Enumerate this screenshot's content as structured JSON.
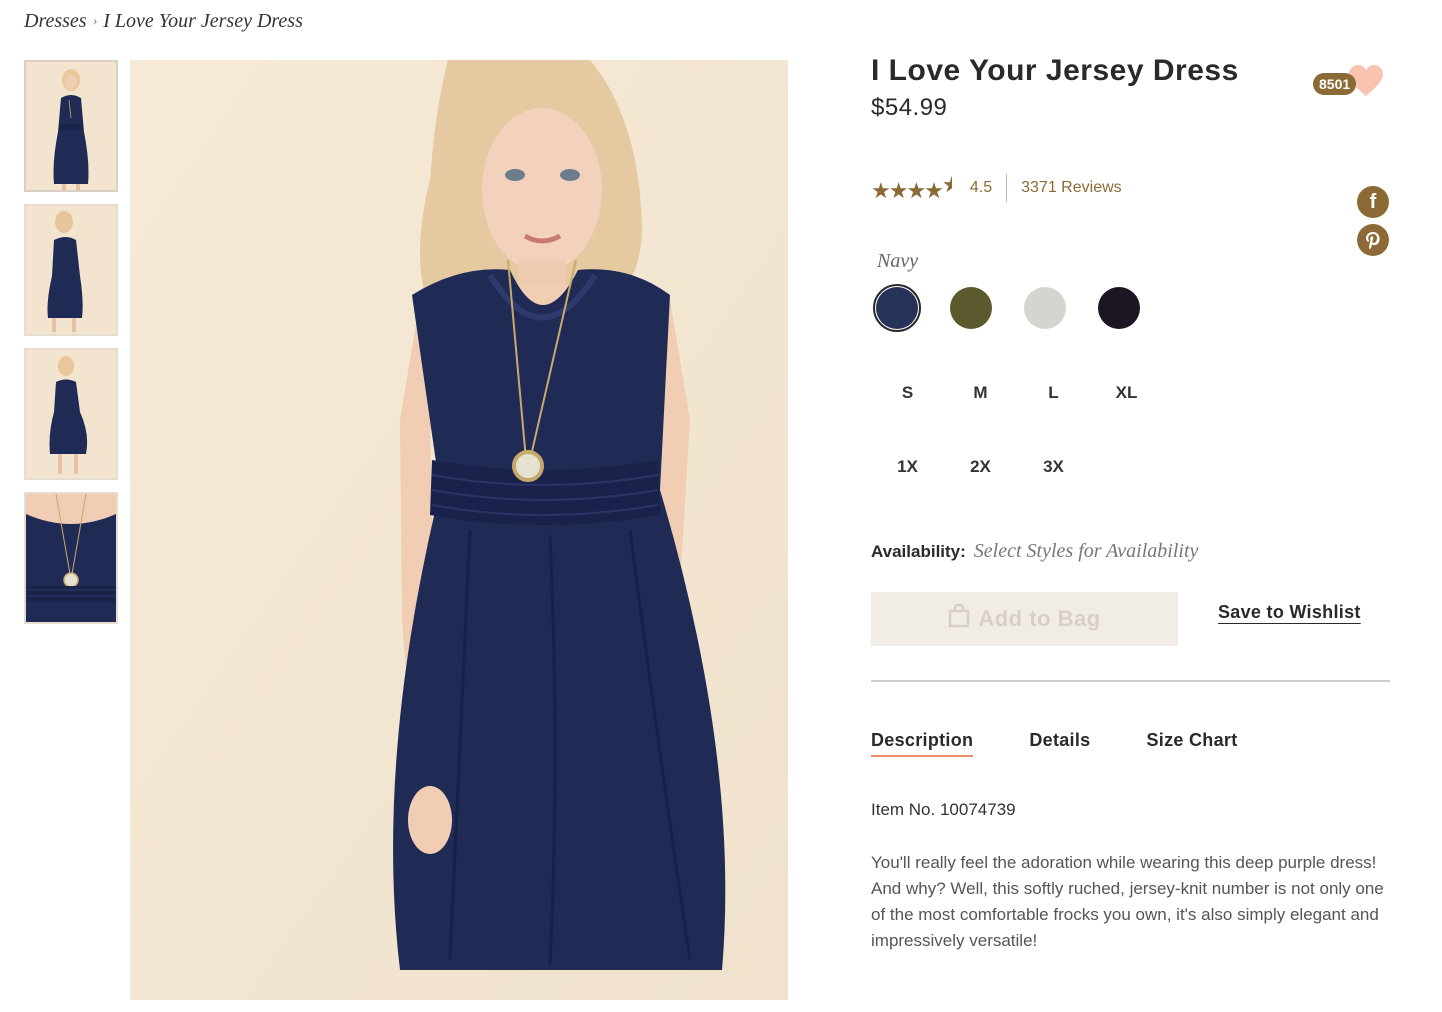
{
  "breadcrumb": {
    "parent": "Dresses",
    "separator": "›",
    "current": "I Love Your Jersey Dress"
  },
  "product": {
    "title": "I Love Your Jersey Dress",
    "price": "$54.99",
    "favorite_count": "8501",
    "rating": {
      "stars": 4.5,
      "value": "4.5",
      "reviews_label": "3371 Reviews"
    },
    "selected_color": "Navy",
    "colors": [
      {
        "name": "Navy",
        "hex": "#263258",
        "selected": true
      },
      {
        "name": "Olive",
        "hex": "#5b5a2f",
        "selected": false
      },
      {
        "name": "Grey",
        "hex": "#d6d4d0",
        "selected": false
      },
      {
        "name": "Black",
        "hex": "#1c1522",
        "selected": false
      }
    ],
    "sizes": [
      "S",
      "M",
      "L",
      "XL",
      "1X",
      "2X",
      "3X"
    ],
    "availability_label": "Availability:",
    "availability_value": "Select Styles for Availability",
    "add_to_bag_label": "Add to Bag",
    "wishlist_label": "Save to Wishlist",
    "tabs": [
      "Description",
      "Details",
      "Size Chart"
    ],
    "active_tab": "Description",
    "item_number": "Item No. 10074739",
    "description": "You'll really feel the adoration while wearing this deep purple dress! And why? Well, this softly ruched, jersey-knit number is not only one of the most comfortable frocks you own, it's also simply elegant and impressively versatile!"
  },
  "social": {
    "facebook_icon": "facebook-icon",
    "pinterest_icon": "pinterest-icon"
  },
  "colors": {
    "accent": "#8c6a36",
    "heart": "#f8c4b0",
    "tab_underline": "#e9916b",
    "dress": "#1f2a55",
    "background": "#f4e7d3"
  }
}
